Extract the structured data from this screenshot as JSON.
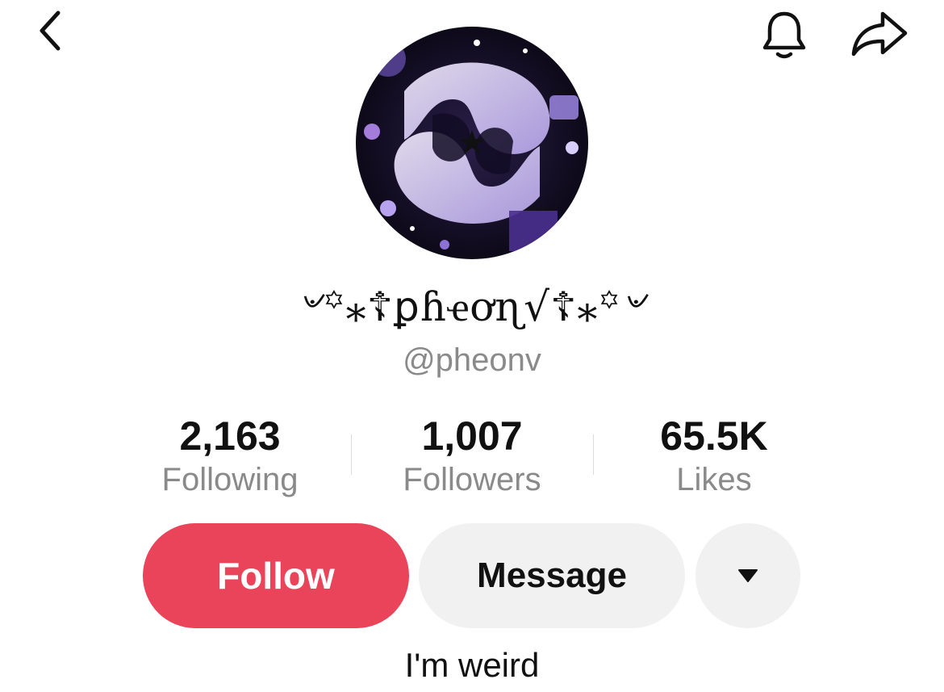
{
  "header": {
    "back_icon": "chevron-left-icon",
    "bell_icon": "bell-icon",
    "share_icon": "share-arrow-icon"
  },
  "profile": {
    "avatar_description_colors": {
      "background": "#0d0a1a",
      "swirl": "#e6ddff",
      "accent": "#7a5cc7"
    },
    "display_name": "৺꙳⁎☦ꝑɦҽơɳ√☦⁎꙳৺",
    "handle": "@pheonv",
    "bio": "I'm weird"
  },
  "stats": [
    {
      "value": "2,163",
      "label": "Following"
    },
    {
      "value": "1,007",
      "label": "Followers"
    },
    {
      "value": "65.5K",
      "label": "Likes"
    }
  ],
  "actions": {
    "follow_label": "Follow",
    "message_label": "Message",
    "more_icon": "caret-down-icon",
    "follow_color": "#ea445a",
    "secondary_color": "#f1f1f1"
  }
}
